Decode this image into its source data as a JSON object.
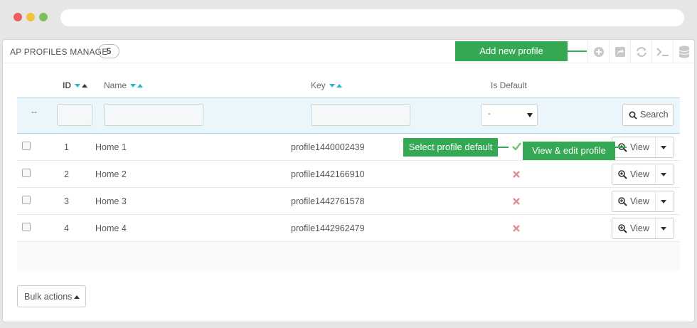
{
  "window": {
    "dot_colors": [
      "#ee5c5c",
      "#f4c13a",
      "#7cc05b"
    ]
  },
  "panel": {
    "title": "AP PROFILES MANAGE",
    "count": "5"
  },
  "toolbar": {
    "icons": [
      "add-circle-icon",
      "export-icon",
      "refresh-icon",
      "terminal-icon",
      "database-icon"
    ]
  },
  "callouts": {
    "add_new": "Add new profile",
    "select_default": "Select profile default",
    "view_edit": "View & edit profile"
  },
  "table": {
    "headers": {
      "id": "ID",
      "name": "Name",
      "key": "Key",
      "is_default": "Is Default"
    },
    "filter": {
      "dash": "--",
      "select_value": "-",
      "search_label": "Search"
    },
    "rows": [
      {
        "id": "1",
        "name": "Home 1",
        "key": "profile1440002439",
        "is_default": true,
        "action": "View"
      },
      {
        "id": "2",
        "name": "Home 2",
        "key": "profile1442166910",
        "is_default": false,
        "action": "View"
      },
      {
        "id": "3",
        "name": "Home 3",
        "key": "profile1442761578",
        "is_default": false,
        "action": "View"
      },
      {
        "id": "4",
        "name": "Home 4",
        "key": "profile1442962479",
        "is_default": false,
        "action": "View"
      }
    ]
  },
  "footer": {
    "bulk_actions": "Bulk actions"
  },
  "colors": {
    "accent": "#25b9d7",
    "callout": "#34a853",
    "check": "#72c279",
    "cross": "#e08f95"
  }
}
